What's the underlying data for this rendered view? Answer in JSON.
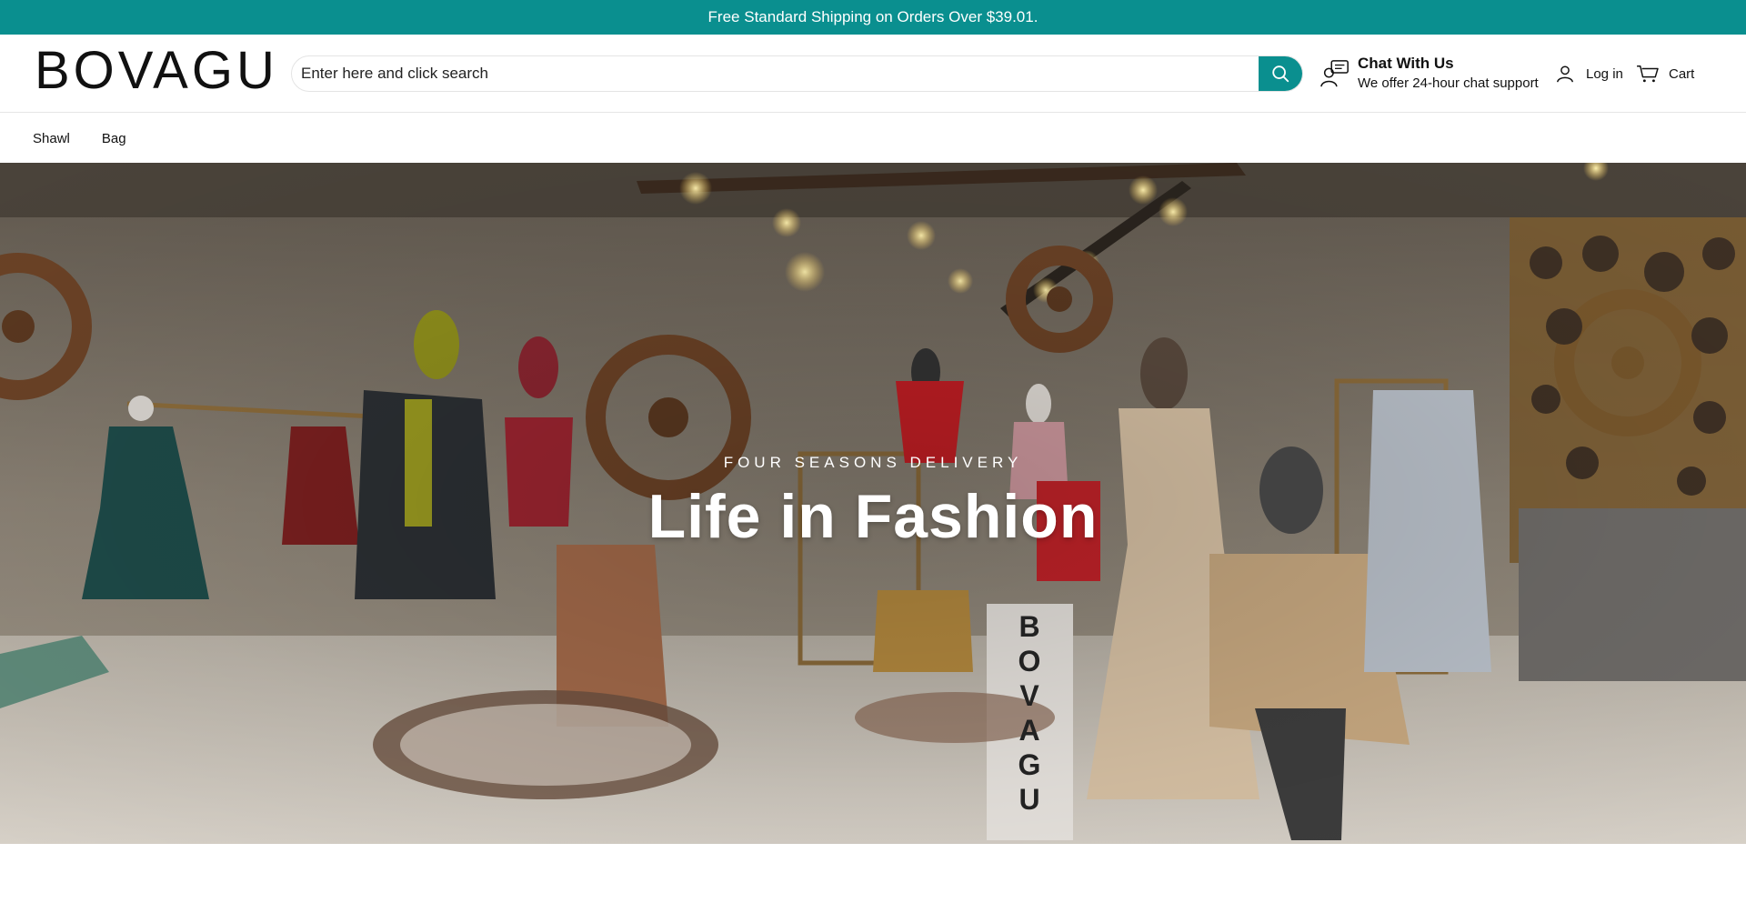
{
  "announcement": {
    "text": "Free Standard Shipping on Orders Over $39.01."
  },
  "header": {
    "logo": "BOVAGU",
    "search": {
      "placeholder": "Enter here and click search",
      "value": ""
    },
    "chat": {
      "title": "Chat With Us",
      "subtitle": "We offer 24-hour chat support"
    },
    "login_label": "Log in",
    "cart_label": "Cart"
  },
  "nav": {
    "items": [
      {
        "label": "Shawl"
      },
      {
        "label": "Bag"
      }
    ]
  },
  "hero": {
    "subtitle": "FOUR SEASONS DELIVERY",
    "title": "Life in Fashion",
    "display_label": "BOVAGU"
  },
  "colors": {
    "accent": "#0a8f8f"
  }
}
